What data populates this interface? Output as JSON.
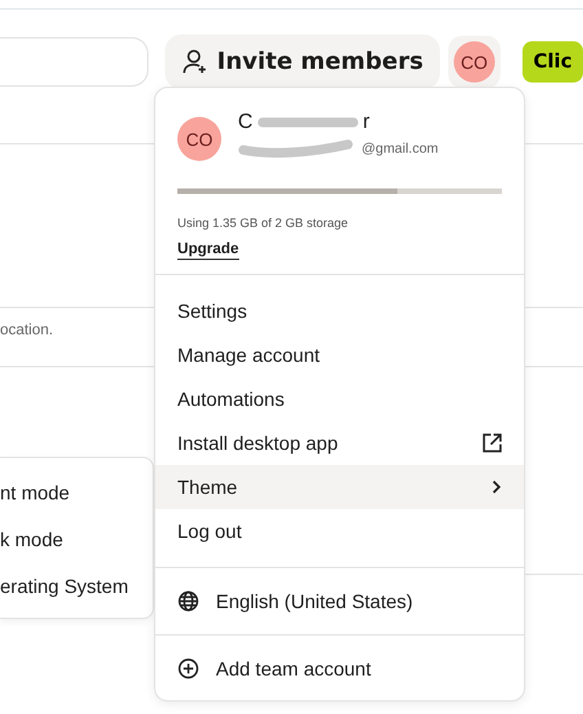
{
  "header": {
    "invite_button": "Invite members",
    "avatar_initials": "CO",
    "cta_button": "Clic"
  },
  "background": {
    "note_fragment": "ocation."
  },
  "account_menu": {
    "avatar_initials": "CO",
    "name_start": "C",
    "name_end": "r",
    "email_end": "@gmail.com",
    "storage": {
      "level": 0.68,
      "text": "Using 1.35 GB of 2 GB storage"
    },
    "upgrade_link": "Upgrade",
    "items": [
      {
        "label": "Settings",
        "kind": "plain",
        "selected": false
      },
      {
        "label": "Manage account",
        "kind": "plain",
        "selected": false
      },
      {
        "label": "Automations",
        "kind": "plain",
        "selected": false
      },
      {
        "label": "Install desktop app",
        "kind": "external",
        "selected": false
      },
      {
        "label": "Theme",
        "kind": "submenu",
        "selected": true
      },
      {
        "label": "Log out",
        "kind": "plain",
        "selected": false
      }
    ],
    "language": "English (United States)",
    "add_account": "Add team account"
  },
  "theme_submenu": {
    "items": [
      "nt mode",
      "k mode",
      "erating System"
    ]
  }
}
